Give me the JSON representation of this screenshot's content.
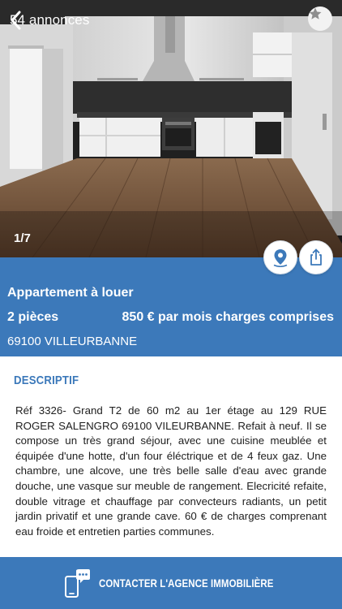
{
  "nav": {
    "back_label": "54 annonces"
  },
  "gallery": {
    "counter": "1/7"
  },
  "listing": {
    "title": "Appartement à louer",
    "rooms": "2 pièces",
    "price": "850 € par mois charges comprises",
    "city": "69100 VILLEURBANNE"
  },
  "description": {
    "heading": "DESCRIPTIF",
    "text": "Réf 3326- Grand T2 de 60 m2 au 1er étage au 129 RUE ROGER SALENGRO 69100 VILEURBANNE. Refait à neuf. Il se compose un très grand séjour, avec une cuisine meublée et équipée d'une hotte, d'un four éléctrique et de 4 feux gaz. Une chambre, une alcove, une très belle salle d'eau avec grande douche, une vasque sur meuble de rangement. Elecricité refaite, double vitrage et chauffage par convecteurs radiants, un petit jardin privatif et une grande cave. 60 € de charges comprenant eau froide et entretien parties communes."
  },
  "footer": {
    "contact_label": "CONTACTER L'AGENCE IMMOBILIÈRE"
  },
  "colors": {
    "brand_blue": "#3c79ba",
    "white": "#ffffff",
    "text_dark": "#1e1e1e"
  },
  "icons": {
    "back": "chevron-left-icon",
    "favorite": "star-icon",
    "map": "map-pin-icon",
    "share": "share-icon",
    "contact": "phone-chat-icon"
  }
}
